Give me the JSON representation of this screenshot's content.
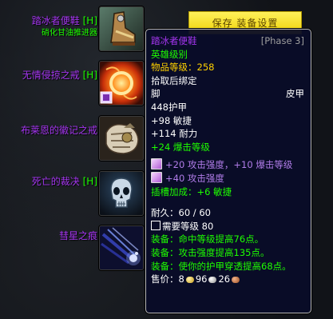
{
  "toolbar": {
    "save_label": "保存 装备设置"
  },
  "slots": [
    {
      "name": "踏冰者便鞋",
      "tag": "[H]",
      "sub": "硝化甘油推进器",
      "icon": "boots-icon"
    },
    {
      "name": "无情侵掠之戒",
      "tag": "[H]",
      "sub": "",
      "icon": "fire-ring-icon"
    },
    {
      "name": "布莱恩的徽记之戒",
      "tag": "",
      "sub": "",
      "icon": "fist-ring-icon"
    },
    {
      "name": "死亡的裁决",
      "tag": "[H]",
      "sub": "",
      "icon": "skull-trinket-icon"
    },
    {
      "name": "彗星之痕",
      "tag": "",
      "sub": "",
      "icon": "comet-trinket-icon"
    }
  ],
  "tooltip": {
    "title": "踏冰者便鞋",
    "phase": "[Phase 3]",
    "quality": "英雄级别",
    "item_level": "物品等级：258",
    "bind": "拾取后绑定",
    "slot": "脚",
    "type": "皮甲",
    "armor": "448护甲",
    "agility": "+98 敏捷",
    "stamina": "+114 耐力",
    "crit": "+24 爆击等级",
    "socket1": "+20 攻击强度，+10 爆击等级",
    "socket2": "+40 攻击强度",
    "socket_bonus": "插槽加成：+6 敏捷",
    "durability": "耐久：60 / 60",
    "req_level": "需要等级 80",
    "equip1": "装备：命中等级提高76点。",
    "equip2": "装备：攻击强度提高135点。",
    "equip3": "装备：使你的护甲穿透提高68点。",
    "sell_label": "售价：",
    "gold": "8",
    "silver": "96",
    "copper": "26"
  },
  "colors": {
    "epic": "#a335ee",
    "uncommon": "#1eff00",
    "gold": "#ffd100"
  }
}
